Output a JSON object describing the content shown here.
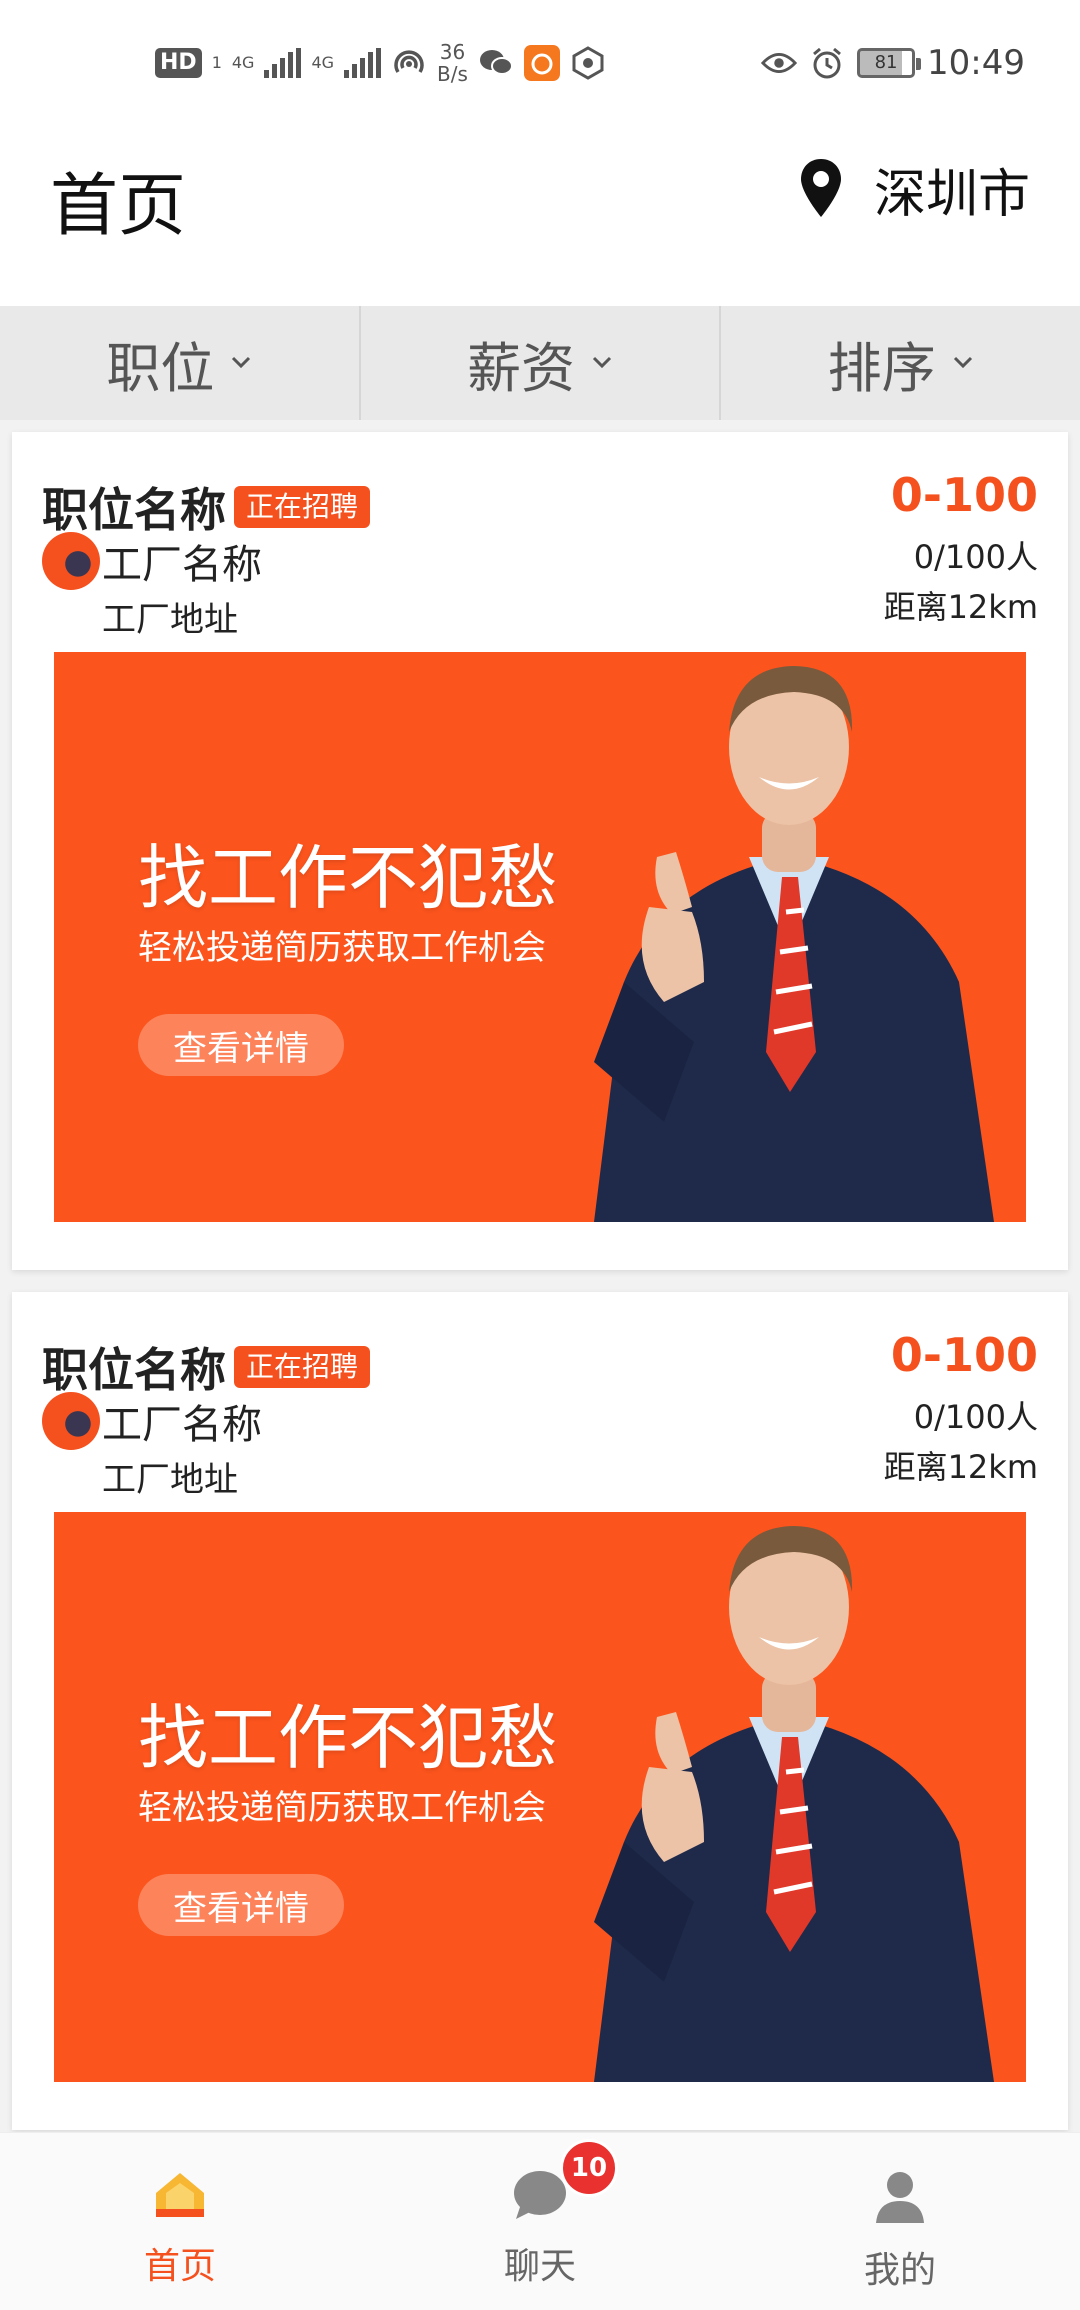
{
  "status_bar": {
    "hd_label": "HD",
    "sim_label": "1",
    "net1": "4G",
    "net2": "4G",
    "speed_value": "36",
    "speed_unit": "B/s",
    "battery": "81",
    "time": "10:49"
  },
  "header": {
    "title": "首页",
    "location": "深圳市"
  },
  "filters": [
    {
      "label": "职位"
    },
    {
      "label": "薪资"
    },
    {
      "label": "排序"
    }
  ],
  "jobs": [
    {
      "title": "职位名称",
      "badge": "正在招聘",
      "salary": "0-100",
      "headcount": "0/100人",
      "distance": "距离12km",
      "factory_name": "工厂名称",
      "factory_address": "工厂地址",
      "banner": {
        "headline": "找工作不犯愁",
        "subline": "轻松投递简历获取工作机会",
        "button": "查看详情"
      }
    },
    {
      "title": "职位名称",
      "badge": "正在招聘",
      "salary": "0-100",
      "headcount": "0/100人",
      "distance": "距离12km",
      "factory_name": "工厂名称",
      "factory_address": "工厂地址",
      "banner": {
        "headline": "找工作不犯愁",
        "subline": "轻松投递简历获取工作机会",
        "button": "查看详情"
      }
    }
  ],
  "bottom_nav": [
    {
      "label": "首页",
      "icon": "home-icon",
      "active": true
    },
    {
      "label": "聊天",
      "icon": "chat-icon",
      "badge": "10"
    },
    {
      "label": "我的",
      "icon": "profile-icon"
    }
  ],
  "colors": {
    "accent": "#f5511e",
    "banner": "#fc541d",
    "badge_red": "#e9322f",
    "home_icon": "#f7b733"
  }
}
